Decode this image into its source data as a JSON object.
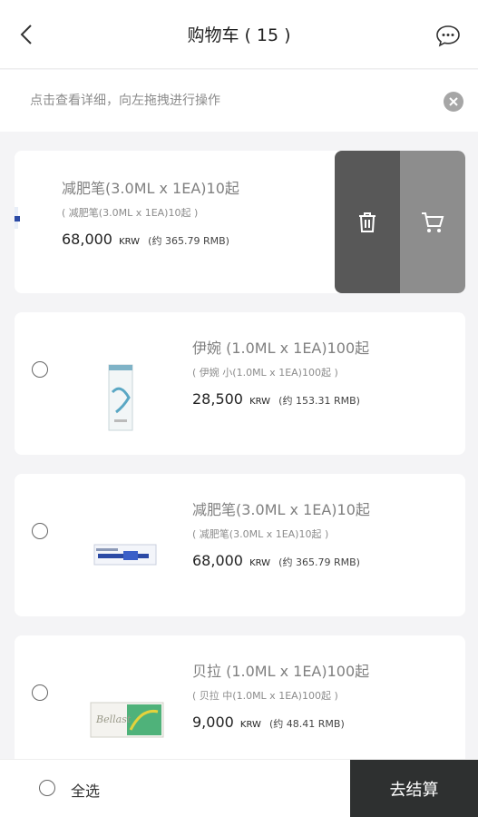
{
  "header": {
    "title": "购物车 ( 15 )"
  },
  "hint": {
    "text": "点击查看详细，向左拖拽进行操作"
  },
  "items": [
    {
      "name": "减肥笔(3.0ML x 1EA)10起",
      "sub": "( 减肥笔(3.0ML x 1EA)10起 )",
      "price": "68,000",
      "currency": "KRW",
      "rmb": "(约 365.79 RMB)",
      "image": "pen-box",
      "swiped": true
    },
    {
      "name": "伊婉 (1.0ML x 1EA)100起",
      "sub": "( 伊婉 小(1.0ML x 1EA)100起 )",
      "price": "28,500",
      "currency": "KRW",
      "rmb": "(约 153.31 RMB)",
      "image": "yvoire-box"
    },
    {
      "name": "减肥笔(3.0ML x 1EA)10起",
      "sub": "( 减肥笔(3.0ML x 1EA)10起 )",
      "price": "68,000",
      "currency": "KRW",
      "rmb": "(约 365.79 RMB)",
      "image": "pen-box"
    },
    {
      "name": "贝拉 (1.0ML x 1EA)100起",
      "sub": "( 贝拉 中(1.0ML x 1EA)100起 )",
      "price": "9,000",
      "currency": "KRW",
      "rmb": "(约 48.41 RMB)",
      "image": "bellast-box"
    }
  ],
  "swipe_actions": {
    "delete_icon": "trash-icon",
    "cart_icon": "cart-icon"
  },
  "footer": {
    "select_all": "全选",
    "checkout": "去结算"
  },
  "colors": {
    "checkout_bg": "#2e3030",
    "delete_bg": "#585858",
    "cart_bg": "#8d8d8d"
  }
}
